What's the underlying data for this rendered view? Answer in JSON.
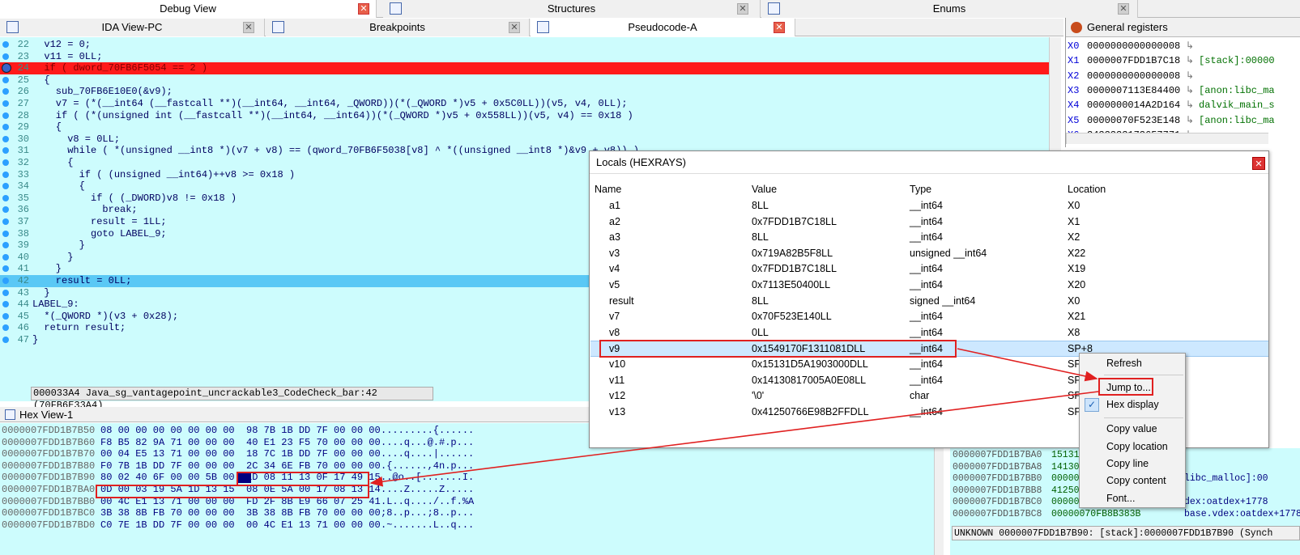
{
  "tabs_top": [
    {
      "label": "Debug View"
    },
    {
      "label": "Structures"
    },
    {
      "label": "Enums"
    }
  ],
  "tabs_sub": [
    {
      "label": "IDA View-PC"
    },
    {
      "label": "Breakpoints"
    },
    {
      "label": "Pseudocode-A"
    }
  ],
  "code": {
    "lines": [
      {
        "n": "22",
        "t": "  v12 = 0;"
      },
      {
        "n": "23",
        "t": "  v11 = 0LL;"
      },
      {
        "n": "24",
        "t": "  if ( dword_70FB6F5054 == 2 )"
      },
      {
        "n": "25",
        "t": "  {"
      },
      {
        "n": "26",
        "t": "    sub_70FB6E10E0(&v9);"
      },
      {
        "n": "27",
        "t": "    v7 = (*(__int64 (__fastcall **)(__int64, __int64, _QWORD))(*(_QWORD *)v5 + 0x5C0LL))(v5, v4, 0LL);"
      },
      {
        "n": "28",
        "t": "    if ( (*(unsigned int (__fastcall **)(__int64, __int64))(*(_QWORD *)v5 + 0x558LL))(v5, v4) == 0x18 )"
      },
      {
        "n": "29",
        "t": "    {"
      },
      {
        "n": "30",
        "t": "      v8 = 0LL;"
      },
      {
        "n": "31",
        "t": "      while ( *(unsigned __int8 *)(v7 + v8) == (qword_70FB6F5038[v8] ^ *((unsigned __int8 *)&v9 + v8)) )"
      },
      {
        "n": "32",
        "t": "      {"
      },
      {
        "n": "33",
        "t": "        if ( (unsigned __int64)++v8 >= 0x18 )"
      },
      {
        "n": "34",
        "t": "        {"
      },
      {
        "n": "35",
        "t": "          if ( (_DWORD)v8 != 0x18 )"
      },
      {
        "n": "36",
        "t": "            break;"
      },
      {
        "n": "37",
        "t": "          result = 1LL;"
      },
      {
        "n": "38",
        "t": "          goto LABEL_9;"
      },
      {
        "n": "39",
        "t": "        }"
      },
      {
        "n": "40",
        "t": "      }"
      },
      {
        "n": "41",
        "t": "    }"
      },
      {
        "n": "42",
        "t": "    result = 0LL;"
      },
      {
        "n": "43",
        "t": "  }"
      },
      {
        "n": "44",
        "t": "LABEL_9:"
      },
      {
        "n": "45",
        "t": "  *(_QWORD *)(v3 + 0x28);"
      },
      {
        "n": "46",
        "t": "  return result;"
      },
      {
        "n": "47",
        "t": "}"
      }
    ],
    "status": "000033A4 Java_sg_vantagepoint_uncrackable3_CodeCheck_bar:42 (70FB6E33A4)"
  },
  "hex": {
    "title": "Hex View-1",
    "rows": [
      {
        "addr": "0000007FDD1B7B50",
        "bytes": "08 00 00 00 00 00 00 00  98 7B 1B DD 7F 00 00 00",
        "ascii": ".........{......"
      },
      {
        "addr": "0000007FDD1B7B60",
        "bytes": "F8 B5 82 9A 71 00 00 00  40 E1 23 F5 70 00 00 00",
        "ascii": "....q...@.#.p..."
      },
      {
        "addr": "0000007FDD1B7B70",
        "bytes": "00 04 E5 13 71 00 00 00  18 7C 1B DD 7F 00 00 00",
        "ascii": "....q....|......"
      },
      {
        "addr": "0000007FDD1B7B80",
        "bytes": "F0 7B 1B DD 7F 00 00 00  2C 34 6E FB 70 00 00 00",
        "ascii": ".{......,4n.p..."
      },
      {
        "addr": "0000007FDD1B7B90",
        "bytes": "80 02 40 6F 00 00 5B 00  1D 08 11 13 0F 17 49 15",
        "ascii": "..@o..[.......I."
      },
      {
        "addr": "0000007FDD1B7BA0",
        "bytes": "0D 00 03 19 5A 1D 13 15  08 0E 5A 00 17 08 13 14",
        "ascii": "....Z.....Z....."
      },
      {
        "addr": "0000007FDD1B7BB0",
        "bytes": "00 4C E1 13 71 00 00 00  FD 2F 8B E9 66 07 25 41",
        "ascii": ".L..q..../..f.%A"
      },
      {
        "addr": "0000007FDD1B7BC0",
        "bytes": "3B 38 8B FB 70 00 00 00  3B 38 8B FB 70 00 00 00",
        "ascii": ";8..p...;8..p..."
      },
      {
        "addr": "0000007FDD1B7BD0",
        "bytes": "C0 7E 1B DD 7F 00 00 00  00 4C E1 13 71 00 00 00",
        "ascii": ".~.......L..q..."
      }
    ]
  },
  "registers": {
    "title": "General registers",
    "rows": [
      {
        "name": "X0",
        "value": "0000000000000008",
        "desc": ""
      },
      {
        "name": "X1",
        "value": "0000007FDD1B7C18",
        "desc": "[stack]:00000"
      },
      {
        "name": "X2",
        "value": "0000000000000008",
        "desc": ""
      },
      {
        "name": "X3",
        "value": "0000007113E84400",
        "desc": "[anon:libc_ma"
      },
      {
        "name": "X4",
        "value": "0000000014A2D164",
        "desc": "dalvik_main_s"
      },
      {
        "name": "X5",
        "value": "00000070F523E148",
        "desc": "[anon:libc_ma"
      },
      {
        "name": "X6",
        "value": "3433333173657771",
        "desc": ""
      }
    ]
  },
  "locals": {
    "title": "Locals (HEXRAYS)",
    "headers": [
      "Name",
      "Value",
      "Type",
      "Location"
    ],
    "rows": [
      {
        "name": "a1",
        "value": "8LL",
        "type": "__int64",
        "loc": "X0"
      },
      {
        "name": "a2",
        "value": "0x7FDD1B7C18LL",
        "type": "__int64",
        "loc": "X1"
      },
      {
        "name": "a3",
        "value": "8LL",
        "type": "__int64",
        "loc": "X2"
      },
      {
        "name": "v3",
        "value": "0x719A82B5F8LL",
        "type": "unsigned __int64",
        "loc": "X22"
      },
      {
        "name": "v4",
        "value": "0x7FDD1B7C18LL",
        "type": "__int64",
        "loc": "X19"
      },
      {
        "name": "v5",
        "value": "0x7113E50400LL",
        "type": "__int64",
        "loc": "X20"
      },
      {
        "name": "result",
        "value": "8LL",
        "type": "signed __int64",
        "loc": "X0"
      },
      {
        "name": "v7",
        "value": "0x70F523E140LL",
        "type": "__int64",
        "loc": "X21"
      },
      {
        "name": "v8",
        "value": "0LL",
        "type": "__int64",
        "loc": "X8"
      },
      {
        "name": "v9",
        "value": "0x1549170F1311081DLL",
        "type": "__int64",
        "loc": "SP+8"
      },
      {
        "name": "v10",
        "value": "0x15131D5A1903000DLL",
        "type": "__int64",
        "loc": "SP"
      },
      {
        "name": "v11",
        "value": "0x14130817005A0E08LL",
        "type": "__int64",
        "loc": "SP"
      },
      {
        "name": "v12",
        "value": "'\\0'",
        "type": "char",
        "loc": "SP"
      },
      {
        "name": "v13",
        "value": "0x41250766E98B2FFDLL",
        "type": "__int64",
        "loc": "SP"
      }
    ]
  },
  "context_menu": {
    "refresh": "Refresh",
    "jump": "Jump to...",
    "hex_display": "Hex display",
    "copy_value": "Copy value",
    "copy_location": "Copy location",
    "copy_line": "Copy line",
    "copy_content": "Copy content",
    "font": "Font..."
  },
  "stack": {
    "rows": [
      {
        "addr": "0000007FDD1B7BA0",
        "val": "15131",
        "desc": ""
      },
      {
        "addr": "0000007FDD1B7BA8",
        "val": "14130",
        "desc": ""
      },
      {
        "addr": "0000007FDD1B7BB0",
        "val": "00000",
        "desc": "libc_malloc]:00"
      },
      {
        "addr": "0000007FDD1B7BB8",
        "val": "41250",
        "desc": ""
      },
      {
        "addr": "0000007FDD1B7BC0",
        "val": "00000",
        "desc": "dex:oatdex+1778"
      },
      {
        "addr": "0000007FDD1B7BC8",
        "val": "00000070FB8B383B",
        "desc": "base.vdex:oatdex+1778"
      }
    ],
    "status": "UNKNOWN 0000007FDD1B7B90: [stack]:0000007FDD1B7B90 (Synch"
  }
}
